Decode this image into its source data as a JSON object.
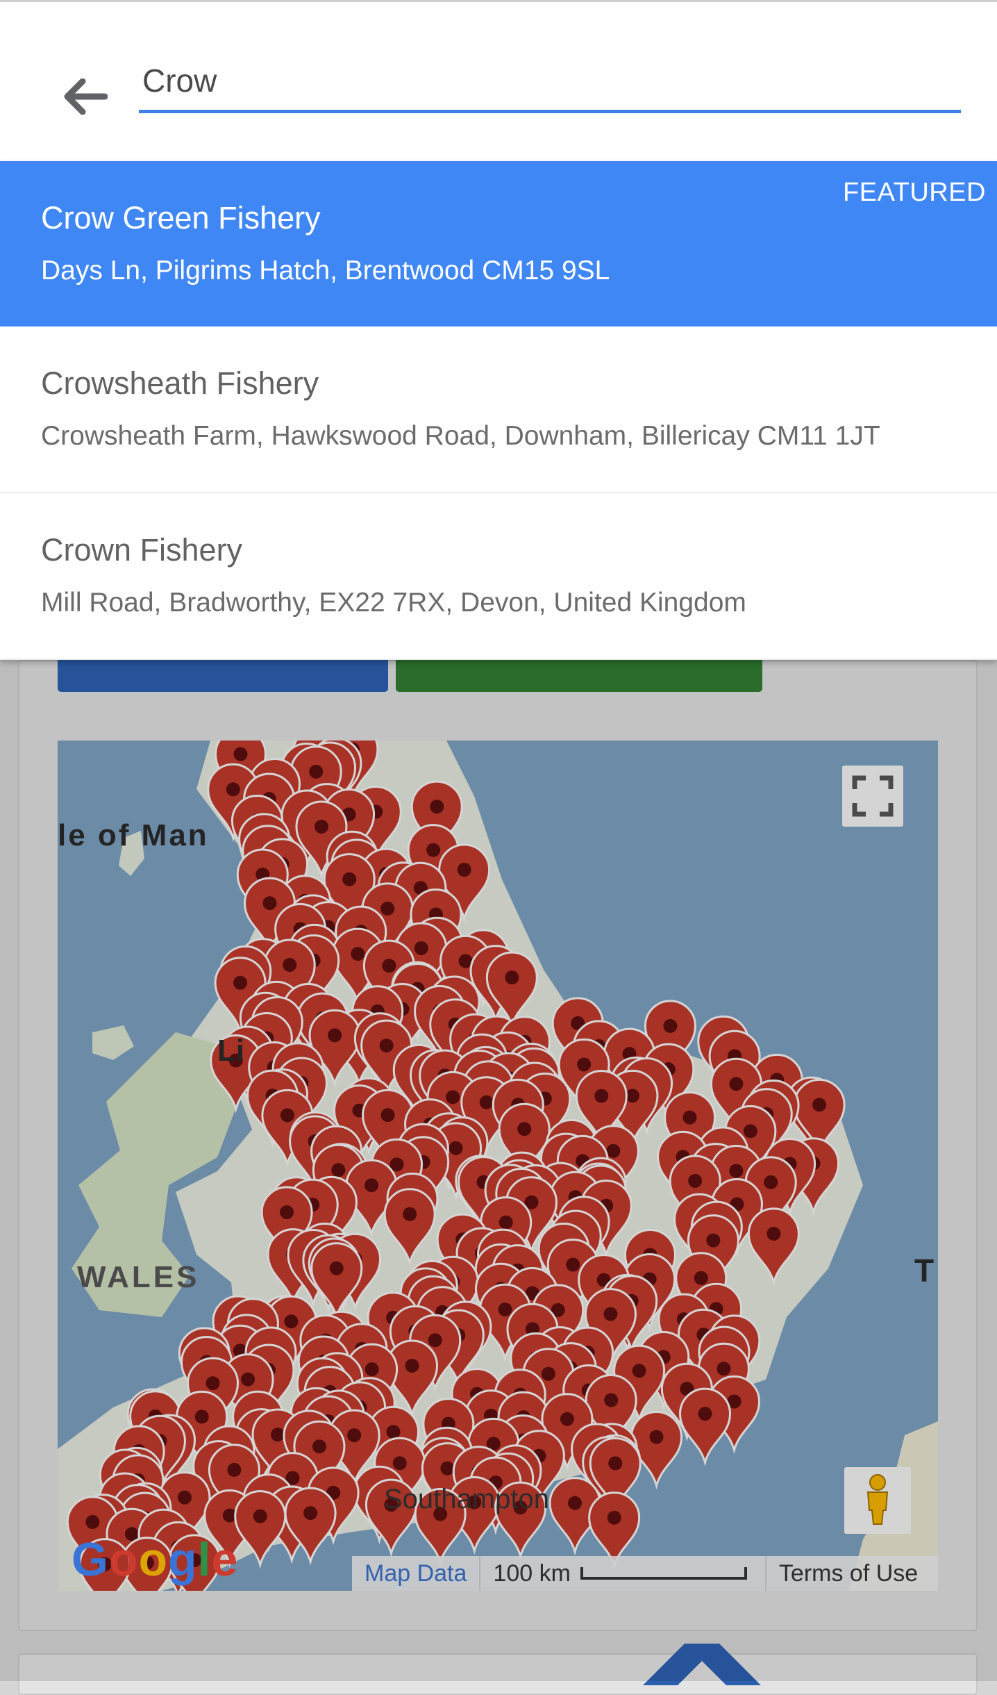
{
  "search": {
    "query": "Crow",
    "back_icon": "arrow-left-icon"
  },
  "suggestions": [
    {
      "name": "Crow Green Fishery",
      "address": "Days Ln, Pilgrims Hatch, Brentwood CM15 9SL",
      "badge": "FEATURED",
      "highlighted": true
    },
    {
      "name": "Crowsheath Fishery",
      "address": "Crowsheath Farm, Hawkswood Road, Downham, Billericay CM11 1JT"
    },
    {
      "name": "Crown Fishery",
      "address": "Mill Road, Bradworthy, EX22 7RX, Devon, United Kingdom"
    }
  ],
  "map": {
    "labels": {
      "isle_of_man": "le of Man",
      "liverpool": "Li",
      "wales": "WALES",
      "southampton": "Southampton",
      "right_edge": "T"
    },
    "footer": {
      "map_data": "Map Data",
      "scale": "100 km",
      "terms": "Terms of Use"
    },
    "logo": "Google",
    "fullscreen_icon": "fullscreen-icon",
    "pegman_icon": "pegman-icon",
    "marker_icon": "map-pin-icon"
  },
  "colors": {
    "accent": "#3f80ea",
    "featured_bg": "#3f87f5",
    "marker": "#c0392b",
    "sea": "#7b9fbd",
    "land": "#dfe4d8"
  }
}
